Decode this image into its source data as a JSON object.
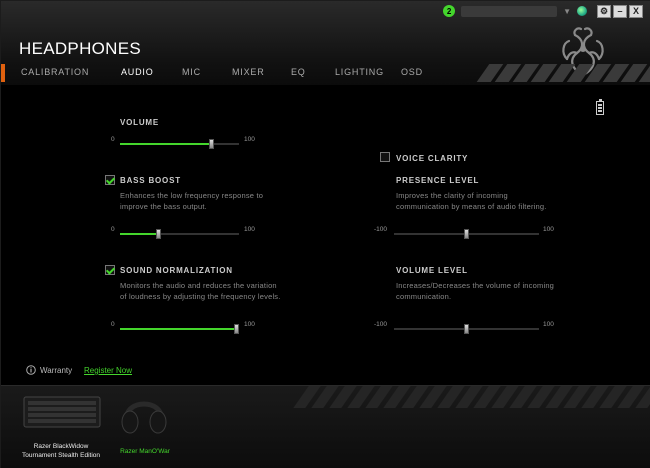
{
  "titlebar": {
    "notification_count": "2",
    "window_buttons": {
      "settings": "⚙",
      "minimize": "–",
      "close": "X"
    }
  },
  "header": {
    "title": "HEADPHONES"
  },
  "nav": {
    "tabs": [
      {
        "label": "CALIBRATION",
        "active": false
      },
      {
        "label": "AUDIO",
        "active": true
      },
      {
        "label": "MIC",
        "active": false
      },
      {
        "label": "MIXER",
        "active": false
      },
      {
        "label": "EQ",
        "active": false
      },
      {
        "label": "LIGHTING",
        "active": false
      },
      {
        "label": "OSD",
        "active": false
      }
    ]
  },
  "audio": {
    "volume": {
      "label": "VOLUME",
      "min": "0",
      "max": "100",
      "value": 77
    },
    "bass_boost": {
      "label": "BASS BOOST",
      "checked": true,
      "desc1": "Enhances the low frequency response to",
      "desc2": "improve the bass output.",
      "min": "0",
      "max": "100",
      "value": 33
    },
    "sound_normalization": {
      "label": "SOUND NORMALIZATION",
      "checked": true,
      "desc1": "Monitors the audio and reduces the variation",
      "desc2": "of loudness by adjusting the frequency levels.",
      "min": "0",
      "max": "100",
      "value": 98
    },
    "voice_clarity": {
      "label": "VOICE CLARITY",
      "checked": false
    },
    "presence_level": {
      "label": "PRESENCE LEVEL",
      "desc1": "Improves the clarity of incoming",
      "desc2": "communication by means of audio filtering.",
      "min": "-100",
      "max": "100",
      "value": 0
    },
    "volume_level": {
      "label": "VOLUME LEVEL",
      "desc1": "Increases/Decreases the volume of incoming",
      "desc2": "communication.",
      "min": "-100",
      "max": "100",
      "value": 0
    }
  },
  "warranty": {
    "label": "Warranty",
    "link": "Register Now"
  },
  "devices": [
    {
      "line1": "Razer BlackWidow",
      "line2": "Tournament Stealth Edition",
      "active": false
    },
    {
      "line1": "Razer ManO'War",
      "line2": "",
      "active": true
    }
  ],
  "colors": {
    "accent": "#44d62c",
    "nav_accent": "#e0610f"
  }
}
